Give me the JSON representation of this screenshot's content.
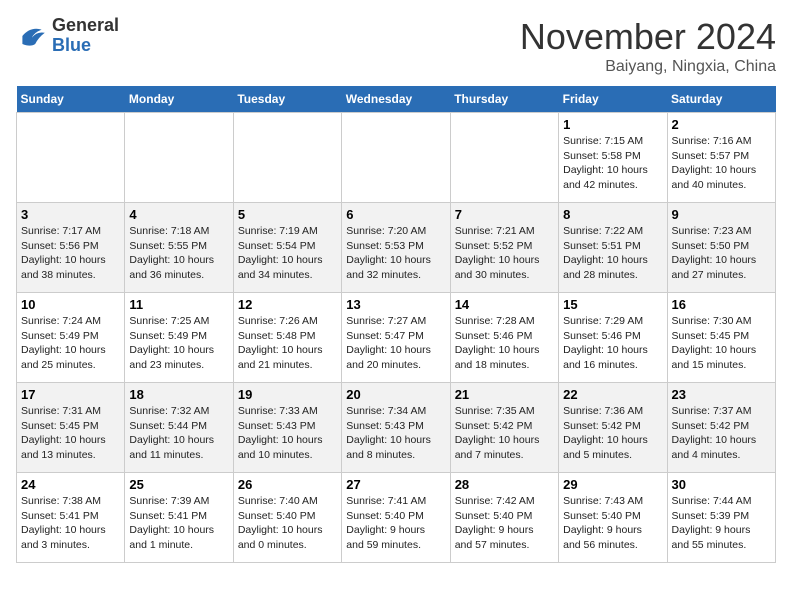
{
  "header": {
    "logo_line1": "General",
    "logo_line2": "Blue",
    "month": "November 2024",
    "location": "Baiyang, Ningxia, China"
  },
  "columns": [
    "Sunday",
    "Monday",
    "Tuesday",
    "Wednesday",
    "Thursday",
    "Friday",
    "Saturday"
  ],
  "weeks": [
    [
      {
        "day": "",
        "info": ""
      },
      {
        "day": "",
        "info": ""
      },
      {
        "day": "",
        "info": ""
      },
      {
        "day": "",
        "info": ""
      },
      {
        "day": "",
        "info": ""
      },
      {
        "day": "1",
        "info": "Sunrise: 7:15 AM\nSunset: 5:58 PM\nDaylight: 10 hours\nand 42 minutes."
      },
      {
        "day": "2",
        "info": "Sunrise: 7:16 AM\nSunset: 5:57 PM\nDaylight: 10 hours\nand 40 minutes."
      }
    ],
    [
      {
        "day": "3",
        "info": "Sunrise: 7:17 AM\nSunset: 5:56 PM\nDaylight: 10 hours\nand 38 minutes."
      },
      {
        "day": "4",
        "info": "Sunrise: 7:18 AM\nSunset: 5:55 PM\nDaylight: 10 hours\nand 36 minutes."
      },
      {
        "day": "5",
        "info": "Sunrise: 7:19 AM\nSunset: 5:54 PM\nDaylight: 10 hours\nand 34 minutes."
      },
      {
        "day": "6",
        "info": "Sunrise: 7:20 AM\nSunset: 5:53 PM\nDaylight: 10 hours\nand 32 minutes."
      },
      {
        "day": "7",
        "info": "Sunrise: 7:21 AM\nSunset: 5:52 PM\nDaylight: 10 hours\nand 30 minutes."
      },
      {
        "day": "8",
        "info": "Sunrise: 7:22 AM\nSunset: 5:51 PM\nDaylight: 10 hours\nand 28 minutes."
      },
      {
        "day": "9",
        "info": "Sunrise: 7:23 AM\nSunset: 5:50 PM\nDaylight: 10 hours\nand 27 minutes."
      }
    ],
    [
      {
        "day": "10",
        "info": "Sunrise: 7:24 AM\nSunset: 5:49 PM\nDaylight: 10 hours\nand 25 minutes."
      },
      {
        "day": "11",
        "info": "Sunrise: 7:25 AM\nSunset: 5:49 PM\nDaylight: 10 hours\nand 23 minutes."
      },
      {
        "day": "12",
        "info": "Sunrise: 7:26 AM\nSunset: 5:48 PM\nDaylight: 10 hours\nand 21 minutes."
      },
      {
        "day": "13",
        "info": "Sunrise: 7:27 AM\nSunset: 5:47 PM\nDaylight: 10 hours\nand 20 minutes."
      },
      {
        "day": "14",
        "info": "Sunrise: 7:28 AM\nSunset: 5:46 PM\nDaylight: 10 hours\nand 18 minutes."
      },
      {
        "day": "15",
        "info": "Sunrise: 7:29 AM\nSunset: 5:46 PM\nDaylight: 10 hours\nand 16 minutes."
      },
      {
        "day": "16",
        "info": "Sunrise: 7:30 AM\nSunset: 5:45 PM\nDaylight: 10 hours\nand 15 minutes."
      }
    ],
    [
      {
        "day": "17",
        "info": "Sunrise: 7:31 AM\nSunset: 5:45 PM\nDaylight: 10 hours\nand 13 minutes."
      },
      {
        "day": "18",
        "info": "Sunrise: 7:32 AM\nSunset: 5:44 PM\nDaylight: 10 hours\nand 11 minutes."
      },
      {
        "day": "19",
        "info": "Sunrise: 7:33 AM\nSunset: 5:43 PM\nDaylight: 10 hours\nand 10 minutes."
      },
      {
        "day": "20",
        "info": "Sunrise: 7:34 AM\nSunset: 5:43 PM\nDaylight: 10 hours\nand 8 minutes."
      },
      {
        "day": "21",
        "info": "Sunrise: 7:35 AM\nSunset: 5:42 PM\nDaylight: 10 hours\nand 7 minutes."
      },
      {
        "day": "22",
        "info": "Sunrise: 7:36 AM\nSunset: 5:42 PM\nDaylight: 10 hours\nand 5 minutes."
      },
      {
        "day": "23",
        "info": "Sunrise: 7:37 AM\nSunset: 5:42 PM\nDaylight: 10 hours\nand 4 minutes."
      }
    ],
    [
      {
        "day": "24",
        "info": "Sunrise: 7:38 AM\nSunset: 5:41 PM\nDaylight: 10 hours\nand 3 minutes."
      },
      {
        "day": "25",
        "info": "Sunrise: 7:39 AM\nSunset: 5:41 PM\nDaylight: 10 hours\nand 1 minute."
      },
      {
        "day": "26",
        "info": "Sunrise: 7:40 AM\nSunset: 5:40 PM\nDaylight: 10 hours\nand 0 minutes."
      },
      {
        "day": "27",
        "info": "Sunrise: 7:41 AM\nSunset: 5:40 PM\nDaylight: 9 hours\nand 59 minutes."
      },
      {
        "day": "28",
        "info": "Sunrise: 7:42 AM\nSunset: 5:40 PM\nDaylight: 9 hours\nand 57 minutes."
      },
      {
        "day": "29",
        "info": "Sunrise: 7:43 AM\nSunset: 5:40 PM\nDaylight: 9 hours\nand 56 minutes."
      },
      {
        "day": "30",
        "info": "Sunrise: 7:44 AM\nSunset: 5:39 PM\nDaylight: 9 hours\nand 55 minutes."
      }
    ]
  ]
}
